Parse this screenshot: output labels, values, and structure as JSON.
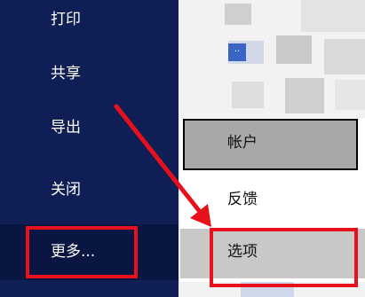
{
  "left_menu": {
    "items": [
      {
        "label": "打印"
      },
      {
        "label": "共享"
      },
      {
        "label": "导出"
      },
      {
        "label": "关闭"
      },
      {
        "label": "更多..."
      }
    ]
  },
  "right_menu": {
    "items": [
      {
        "label": "帐户"
      },
      {
        "label": "反馈"
      },
      {
        "label": "选项"
      }
    ]
  },
  "background_chip": {
    "label": ".."
  },
  "colors": {
    "panel_navy": "#0f1f55",
    "highlight_red": "#e8101a",
    "account_grey": "#a8a8a8"
  }
}
